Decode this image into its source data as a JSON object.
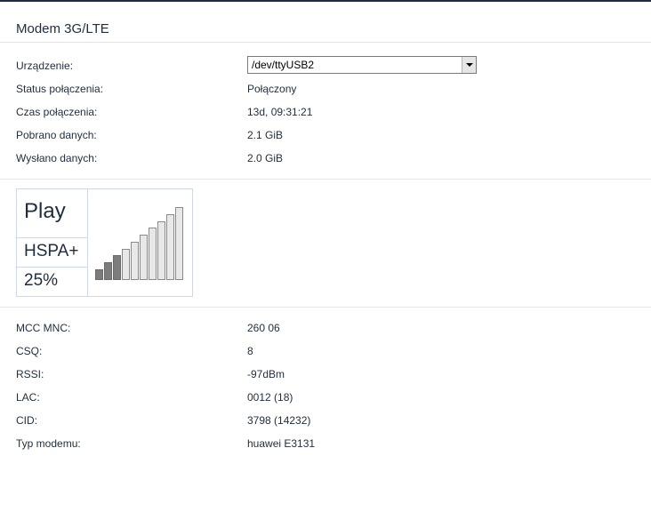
{
  "page": {
    "title": "Modem 3G/LTE"
  },
  "info": {
    "device_label": "Urządzenie:",
    "device_value": "/dev/ttyUSB2",
    "rows": [
      {
        "label": "Status połączenia:",
        "value": "Połączony"
      },
      {
        "label": "Czas połączenia:",
        "value": "13d, 09:31:21"
      },
      {
        "label": "Pobrano danych:",
        "value": "2.1 GiB"
      },
      {
        "label": "Wysłano danych:",
        "value": "2.0 GiB"
      }
    ]
  },
  "signal": {
    "operator": "Play",
    "technology": "HSPA+",
    "percent_text": "25%",
    "strength_percent": 25,
    "bar_count": 10,
    "bars_active": 3,
    "colors": {
      "active": "#7c7c7c",
      "inactive": "#e8e8e8"
    }
  },
  "details": {
    "rows": [
      {
        "label": "MCC MNC:",
        "value": "260 06"
      },
      {
        "label": "CSQ:",
        "value": "8"
      },
      {
        "label": "RSSI:",
        "value": "-97dBm"
      },
      {
        "label": "LAC:",
        "value": "0012 (18)"
      },
      {
        "label": "CID:",
        "value": "3798 (14232)"
      },
      {
        "label": "Typ modemu:",
        "value": "huawei E3131"
      }
    ]
  }
}
